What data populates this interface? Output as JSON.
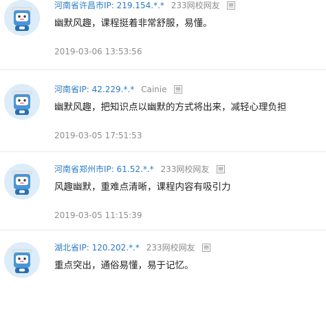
{
  "comments": [
    {
      "location": "河南省许昌市",
      "ip": "IP: 219.154.*.*",
      "user": "233网校网友",
      "text": "幽默风趣，课程挺着非常舒服，易懂。",
      "time": "2019-03-06 13:53:56"
    },
    {
      "location": "河南省",
      "ip": "IP: 42.229.*.*",
      "user": "Cainie",
      "text": "幽默风趣，把知识点以幽默的方式将出来，减轻心理负担",
      "time": "2019-03-05 17:51:53"
    },
    {
      "location": "河南省郑州市",
      "ip": "IP: 61.52.*.*",
      "user": "233网校网友",
      "text": "风趣幽默，重难点清晰，课程内容有吸引力",
      "time": "2019-03-05 11:15:39"
    },
    {
      "location": "湖北省",
      "ip": "IP: 120.202.*.*",
      "user": "233网校网友",
      "text": "重点突出，通俗易懂，易于记忆。",
      "time": ""
    }
  ],
  "icons": {
    "avatar": "robot-avatar-icon",
    "user": "user-card-icon"
  },
  "colors": {
    "link": "#2a7bc4",
    "muted": "#8c8c8c",
    "text": "#222222",
    "avatar_face": "#4a95d6",
    "avatar_bg": "#dcecf8"
  }
}
